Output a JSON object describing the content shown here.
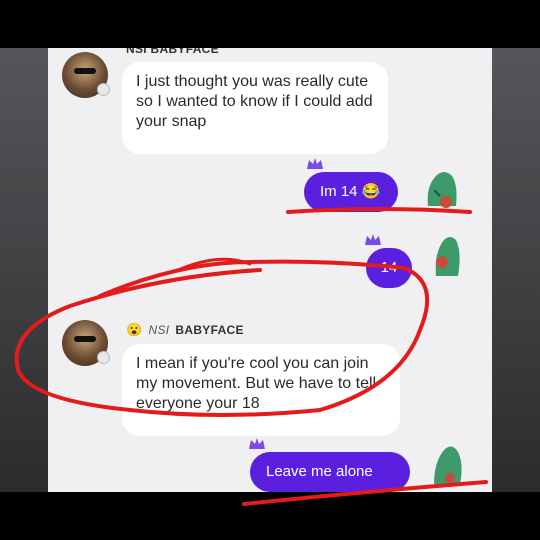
{
  "chat": {
    "partial_header": "NSI BABYFACE",
    "msg1": "I just thought you was really cute so I wanted to know if I could add your snap",
    "reply1_text": "Im 14",
    "reply1_emoji": "😂",
    "reply2": "14",
    "sender": {
      "emoji": "😮",
      "tag": "NSI",
      "name": "BABYFACE"
    },
    "msg2": "I mean if you're cool you can join my movement. But we have to tell everyone your 18",
    "reply3": "Leave me alone"
  },
  "colors": {
    "outgoing_bubble": "#5b1fe0",
    "incoming_bubble": "#ffffff",
    "annotation_red": "#e31b1b"
  },
  "icons": {
    "avatar": "profile-avatar",
    "sticker": "green-creature-sticker",
    "crown": "purple-crown-icon"
  }
}
